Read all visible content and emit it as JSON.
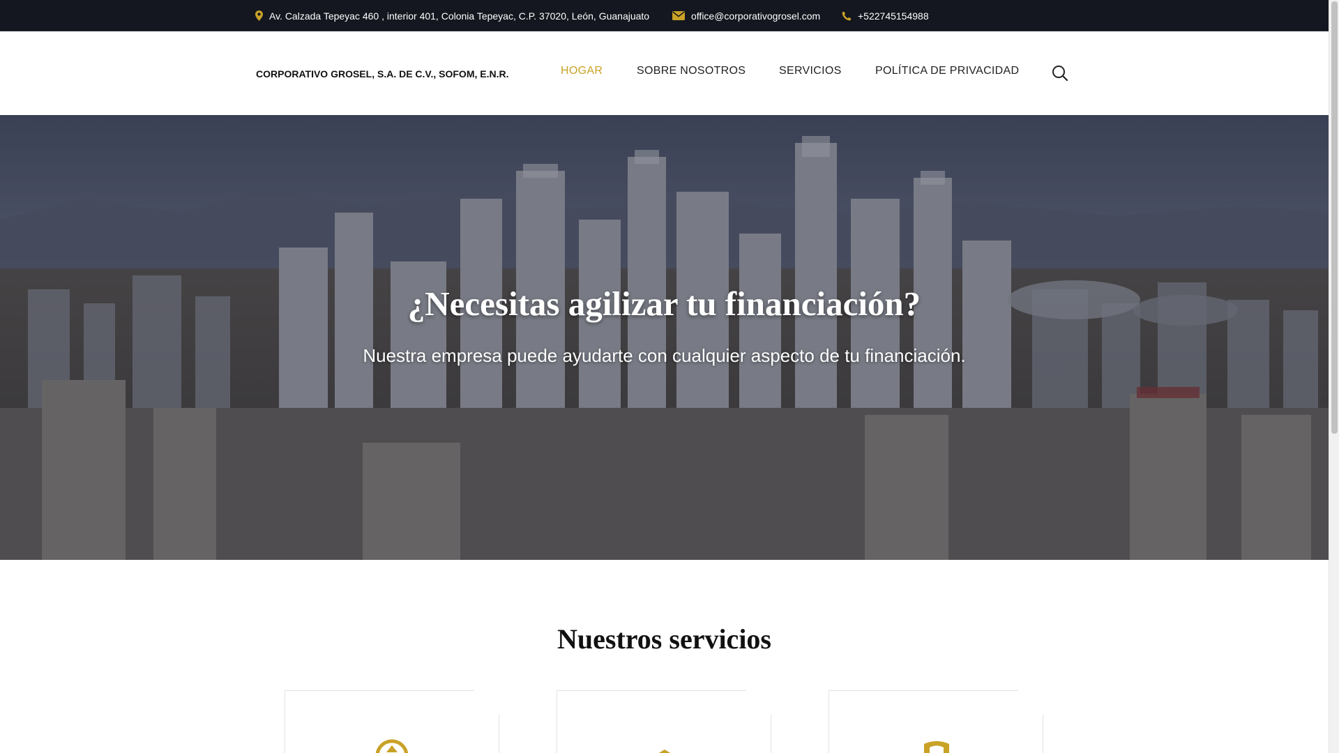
{
  "topbar": {
    "address": "Av. Calzada Tepeyac 460 , interior 401, Colonia Tepeyac, C.P. 37020, León, Guanajuato",
    "email": "office@corporativogrosel.com",
    "phone": "+522745154988",
    "icons": [
      "map-marker-icon",
      "envelope-icon",
      "phone-icon"
    ]
  },
  "header": {
    "logo": "CORPORATIVO GROSEL, S.A. DE C.V., SOFOM, E.N.R.",
    "nav": [
      "HOGAR",
      "SOBRE NOSOTROS",
      "SERVICIOS",
      "POLÍTICA DE PRIVACIDAD"
    ],
    "active_nav": "HOGAR",
    "search_icon": "search-icon"
  },
  "hero": {
    "title": "¿Necesitas agilizar tu financiación?",
    "subtitle": "Nuestra empresa puede ayudarte con cualquier aspecto de tu financiación."
  },
  "services": {
    "title": "Nuestros servicios",
    "cards": [
      {
        "icon": "dollar-circle-icon"
      },
      {
        "icon": "coins-icon"
      },
      {
        "icon": "shield-icon"
      }
    ]
  },
  "colors": {
    "accent": "#c9a227",
    "topbar_bg": "#14171f",
    "text_dark": "#111111"
  }
}
